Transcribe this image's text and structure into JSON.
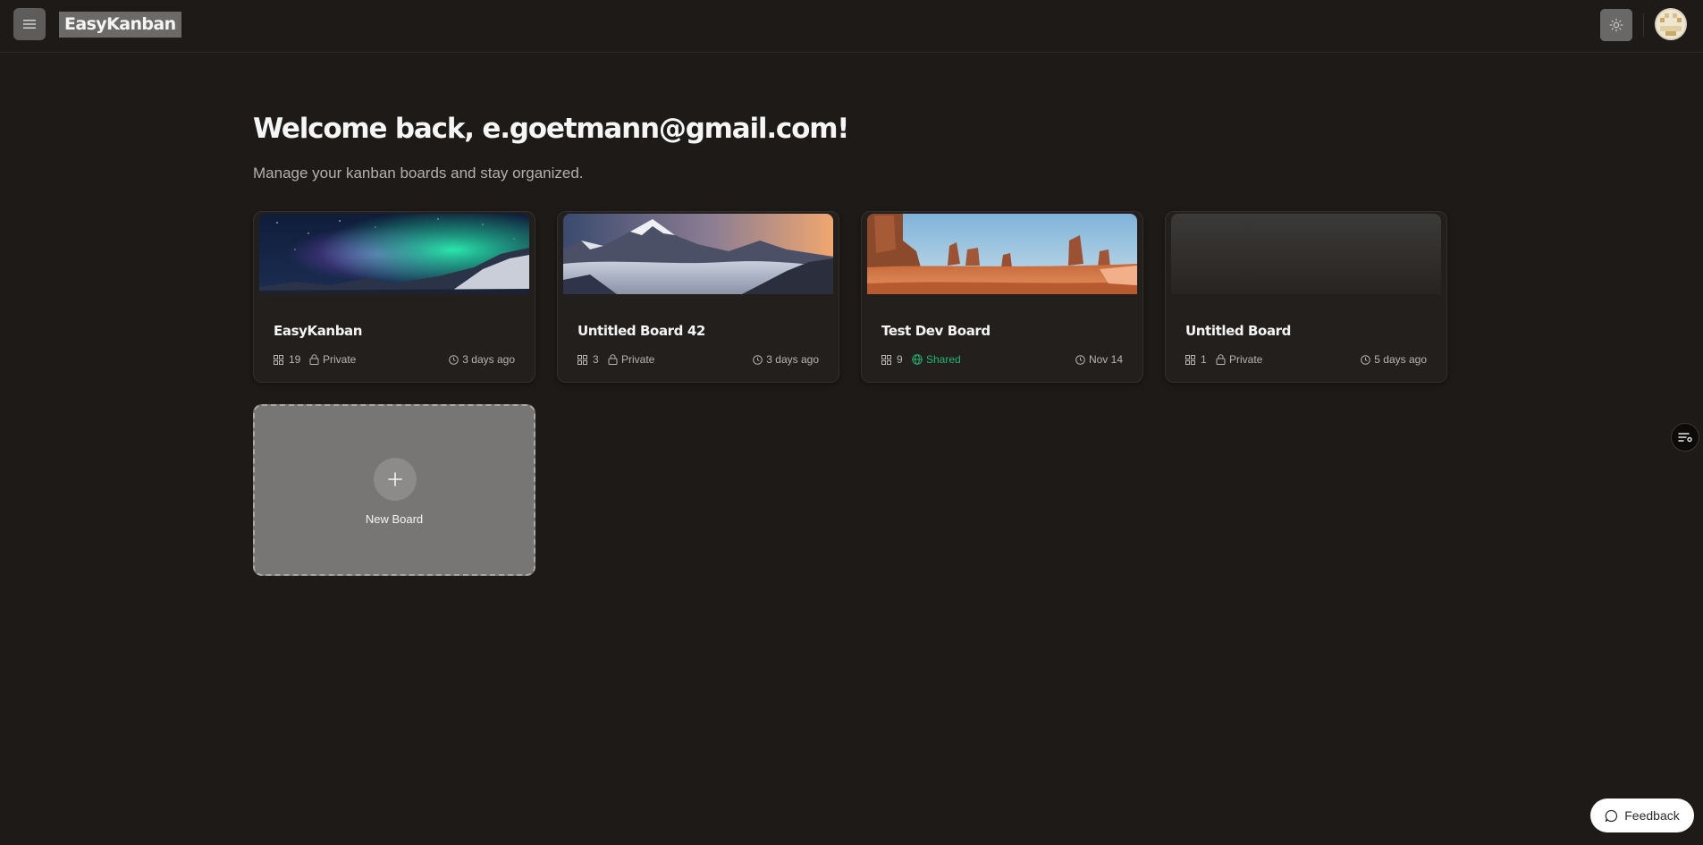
{
  "app": {
    "logo_text": "EasyKanban"
  },
  "header": {
    "menu_icon": "hamburger-icon",
    "theme_icon": "sun-icon"
  },
  "main": {
    "title": "Welcome back, e.goetmann@gmail.com!",
    "subtitle": "Manage your kanban boards and stay organized."
  },
  "boards": [
    {
      "name": "EasyKanban",
      "count": "19",
      "visibility": "Private",
      "updated": "3 days ago",
      "cover": "aurora"
    },
    {
      "name": "Untitled Board 42",
      "count": "3",
      "visibility": "Private",
      "updated": "3 days ago",
      "cover": "mountains"
    },
    {
      "name": "Test Dev Board",
      "count": "9",
      "visibility": "Shared",
      "updated": "Nov 14",
      "cover": "desert"
    },
    {
      "name": "Untitled Board",
      "count": "1",
      "visibility": "Private",
      "updated": "5 days ago",
      "cover": "none"
    }
  ],
  "new_board": {
    "label": "New Board"
  },
  "feedback": {
    "label": "Feedback"
  },
  "colors": {
    "background": "#1d1a18",
    "card": "#221f1d",
    "shared": "#22b573",
    "new_board": "#777675"
  }
}
